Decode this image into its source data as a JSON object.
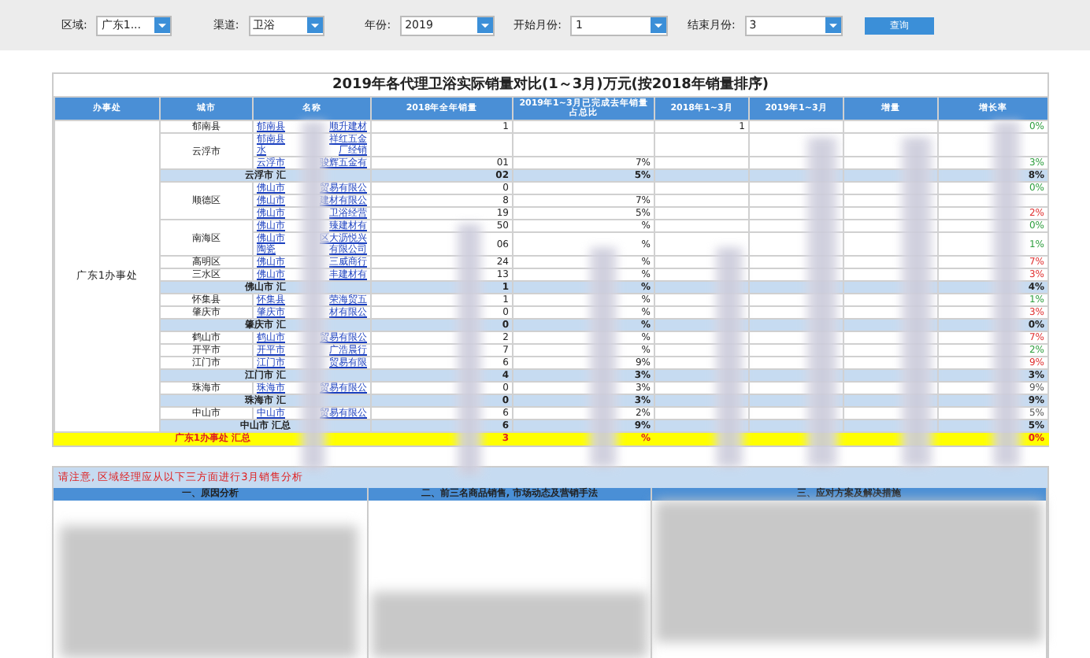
{
  "filters": [
    {
      "label": "区域:",
      "value": "广东1...",
      "kind": "select"
    },
    {
      "label": "渠道:",
      "value": "卫浴",
      "kind": "select"
    },
    {
      "label": "年份:",
      "value": "2019",
      "kind": "select"
    },
    {
      "label": "开始月份:",
      "value": "1",
      "kind": "select"
    },
    {
      "label": "结束月份:",
      "value": "3",
      "kind": "select"
    }
  ],
  "query_button": "查询",
  "report": {
    "title": "2019年各代理卫浴实际销量对比(1～3月)万元(按2018年销量排序)",
    "columns": [
      "办事处",
      "城市",
      "名称",
      "2018年全年销量",
      "2019年1~3月已完成去年销量占总比",
      "2018年1~3月",
      "2019年1~3月",
      "增量",
      "增长率"
    ],
    "office": "广东1办事处",
    "groups": [
      {
        "kind": "city",
        "city": "郁南县",
        "agents": [
          {
            "lines": [
              [
                "郁南县",
                "顺升建材"
              ]
            ],
            "sales_2018": "1",
            "q1_2018": "1",
            "growth": "0%",
            "color": "#2e9e3e"
          }
        ]
      },
      {
        "kind": "city",
        "city": "云浮市",
        "agents": [
          {
            "lines": [
              [
                "郁南县",
                "祥红五金"
              ],
              [
                "水",
                "厂经销"
              ]
            ]
          },
          {
            "lines": [
              [
                "云浮市",
                "骏辉五金有"
              ]
            ],
            "sales_2018": "01",
            "share": "7%",
            "growth": "3%",
            "color": "#2e9e3e"
          }
        ]
      },
      {
        "kind": "subtotal",
        "label": "云浮市 汇",
        "sales_2018": "02",
        "share": "5%",
        "growth": "8%",
        "color": "#222222"
      },
      {
        "kind": "city",
        "city": "顺德区",
        "agents": [
          {
            "lines": [
              [
                "佛山市",
                "贸易有限公"
              ]
            ],
            "sales_2018": "0",
            "growth": "0%",
            "color": "#2e9e3e"
          },
          {
            "lines": [
              [
                "佛山市",
                "建材有限公"
              ]
            ],
            "sales_2018": "8",
            "share": "7%"
          },
          {
            "lines": [
              [
                "佛山市",
                "卫浴经营"
              ]
            ],
            "sales_2018": "19",
            "share": "5%",
            "growth": "2%",
            "color": "#e03030"
          }
        ]
      },
      {
        "kind": "city",
        "city": "南海区",
        "agents": [
          {
            "lines": [
              [
                "佛山市",
                "臻建材有"
              ]
            ],
            "sales_2018": "50",
            "share": "%",
            "growth": "0%",
            "color": "#2e9e3e"
          },
          {
            "lines": [
              [
                "佛山市",
                "区大沥悦兴"
              ],
              [
                "陶瓷",
                "有限公司"
              ]
            ],
            "sales_2018": "06",
            "share": "%",
            "growth": "1%",
            "color": "#2e9e3e"
          }
        ]
      },
      {
        "kind": "city",
        "city": "高明区",
        "agents": [
          {
            "lines": [
              [
                "佛山市",
                "三威商行"
              ]
            ],
            "sales_2018": "24",
            "share": "%",
            "growth": "7%",
            "color": "#e03030"
          }
        ]
      },
      {
        "kind": "city",
        "city": "三水区",
        "agents": [
          {
            "lines": [
              [
                "佛山市",
                "丰建材有"
              ]
            ],
            "sales_2018": "13",
            "share": "%",
            "growth": "3%",
            "color": "#e03030"
          }
        ]
      },
      {
        "kind": "subtotal",
        "label": "佛山市 汇",
        "sales_2018": "1",
        "share": "%",
        "growth": "4%",
        "color": "#222222"
      },
      {
        "kind": "city",
        "city": "怀集县",
        "agents": [
          {
            "lines": [
              [
                "怀集县",
                "荣海贸五"
              ]
            ],
            "sales_2018": "1",
            "share": "%",
            "growth": "1%",
            "color": "#2e9e3e"
          }
        ]
      },
      {
        "kind": "city",
        "city": "肇庆市",
        "agents": [
          {
            "lines": [
              [
                "肇庆市",
                "材有限公"
              ]
            ],
            "sales_2018": "0",
            "share": "%",
            "growth": "3%",
            "color": "#e03030"
          }
        ]
      },
      {
        "kind": "subtotal",
        "label": "肇庆市 汇",
        "sales_2018": "0",
        "share": "%",
        "growth": "0%",
        "color": "#222222"
      },
      {
        "kind": "city",
        "city": "鹤山市",
        "agents": [
          {
            "lines": [
              [
                "鹤山市",
                "贸易有限公"
              ]
            ],
            "sales_2018": "2",
            "share": "%",
            "growth": "7%",
            "color": "#e03030"
          }
        ]
      },
      {
        "kind": "city",
        "city": "开平市",
        "agents": [
          {
            "lines": [
              [
                "开平市",
                "广浩晨行"
              ]
            ],
            "sales_2018": "7",
            "share": "%",
            "growth": "2%",
            "color": "#2e9e3e"
          }
        ]
      },
      {
        "kind": "city",
        "city": "江门市",
        "agents": [
          {
            "lines": [
              [
                "江门市",
                "贸易有限"
              ]
            ],
            "sales_2018": "6",
            "share": "9%",
            "growth": "9%",
            "color": "#e03030"
          }
        ]
      },
      {
        "kind": "subtotal",
        "label": "江门市 汇",
        "sales_2018": "4",
        "share": "3%",
        "growth": "3%",
        "color": "#222222"
      },
      {
        "kind": "city",
        "city": "珠海市",
        "agents": [
          {
            "lines": [
              [
                "珠海市",
                "贸易有限公"
              ]
            ],
            "sales_2018": "0",
            "share": "3%",
            "growth": "9%",
            "color": "#555555"
          }
        ]
      },
      {
        "kind": "subtotal",
        "label": "珠海市 汇",
        "sales_2018": "0",
        "share": "3%",
        "growth": "9%",
        "color": "#222222"
      },
      {
        "kind": "city",
        "city": "中山市",
        "agents": [
          {
            "lines": [
              [
                "中山市",
                "贸易有限公"
              ]
            ],
            "sales_2018": "6",
            "share": "2%",
            "growth": "5%",
            "color": "#555555"
          }
        ]
      },
      {
        "kind": "subtotal",
        "label": "中山市 汇总",
        "sales_2018": "6",
        "share": "9%",
        "growth": "5%",
        "color": "#222222"
      }
    ],
    "total": {
      "label": "广东1办事处 汇总",
      "sales_2018": "3",
      "share": "%",
      "growth": "0%"
    }
  },
  "analysis": {
    "note": "请注意, 区域经理应从以下三方面进行3月销售分析",
    "headings": [
      "一、原因分析",
      "二、前三名商品销售, 市场动态及营销手法",
      "三、应对方案及解决措施"
    ]
  }
}
